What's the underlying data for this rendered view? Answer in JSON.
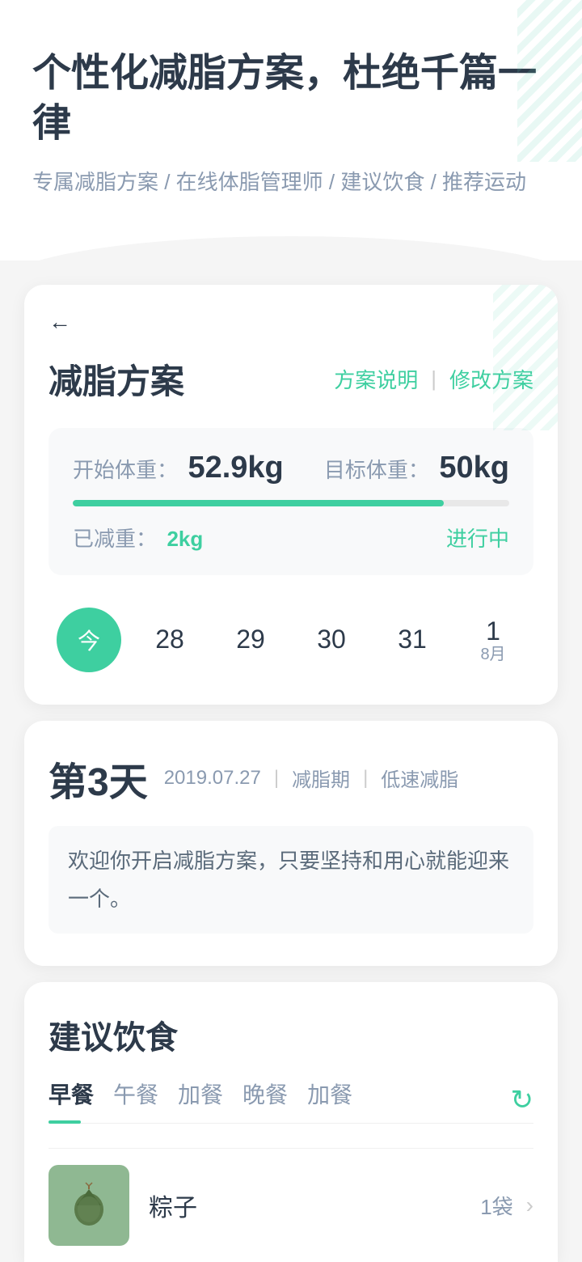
{
  "header": {
    "main_title": "个性化减脂方案，杜绝千篇一律",
    "sub_title": "专属减脂方案 / 在线体脂管理师 / 建议饮食 / 推荐运动"
  },
  "plan_card": {
    "back_icon": "←",
    "title": "减脂方案",
    "action_explain": "方案说明",
    "action_divider": "|",
    "action_modify": "修改方案",
    "start_label": "开始体重：",
    "start_value": "52.9kg",
    "target_label": "目标体重：",
    "target_value": "50kg",
    "progress_percent": 85,
    "lost_label": "已减重：",
    "lost_value": "2kg",
    "status": "进行中"
  },
  "calendar": {
    "today_label": "今",
    "days": [
      "28",
      "29",
      "30",
      "31"
    ],
    "next_day": "1",
    "next_month": "8月"
  },
  "day_info": {
    "day_title": "第3天",
    "date": "2019.07.27",
    "sep1": "|",
    "tag1": "减脂期",
    "sep2": "|",
    "tag2": "低速减脂",
    "welcome": "欢迎你开启减脂方案，只要坚持和用心就能迎来一个。"
  },
  "diet": {
    "title": "建议饮食",
    "tabs": [
      {
        "label": "早餐",
        "active": true
      },
      {
        "label": "午餐",
        "active": false
      },
      {
        "label": "加餐",
        "active": false
      },
      {
        "label": "晚餐",
        "active": false
      },
      {
        "label": "加餐",
        "active": false
      }
    ],
    "refresh_icon": "↻",
    "food_items": [
      {
        "name": "粽子",
        "amount": "1袋",
        "has_arrow": true
      }
    ]
  }
}
